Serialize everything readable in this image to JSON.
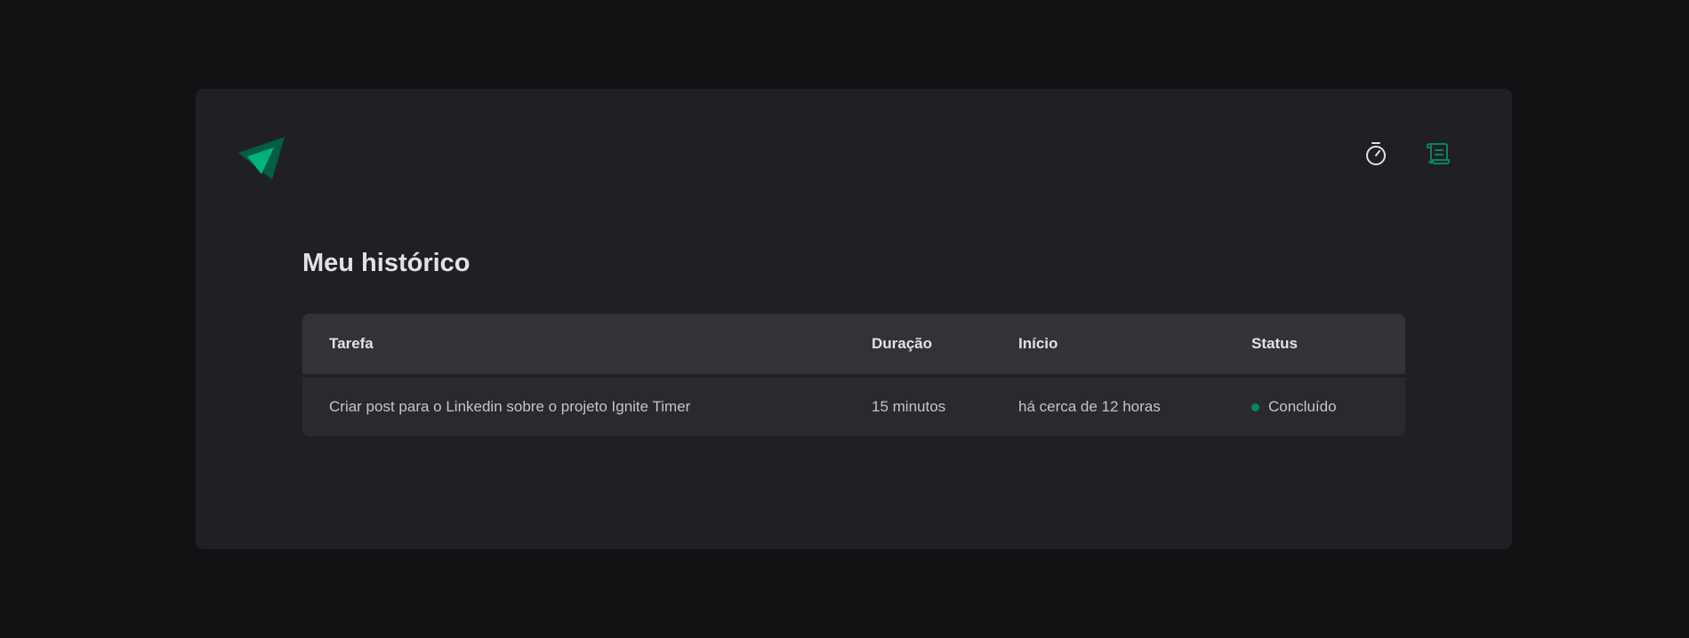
{
  "nav": {
    "items": [
      {
        "icon": "timer-icon",
        "active": false
      },
      {
        "icon": "scroll-icon",
        "active": true
      }
    ]
  },
  "colors": {
    "accent": "#00875F",
    "accent_light": "#00B37E",
    "active_status": "#00875F"
  },
  "history": {
    "title": "Meu histórico",
    "columns": [
      "Tarefa",
      "Duração",
      "Início",
      "Status"
    ],
    "rows": [
      {
        "task": "Criar post para o Linkedin sobre o projeto Ignite Timer",
        "duration": "15 minutos",
        "start": "há cerca de 12 horas",
        "status": "Concluído"
      }
    ]
  }
}
